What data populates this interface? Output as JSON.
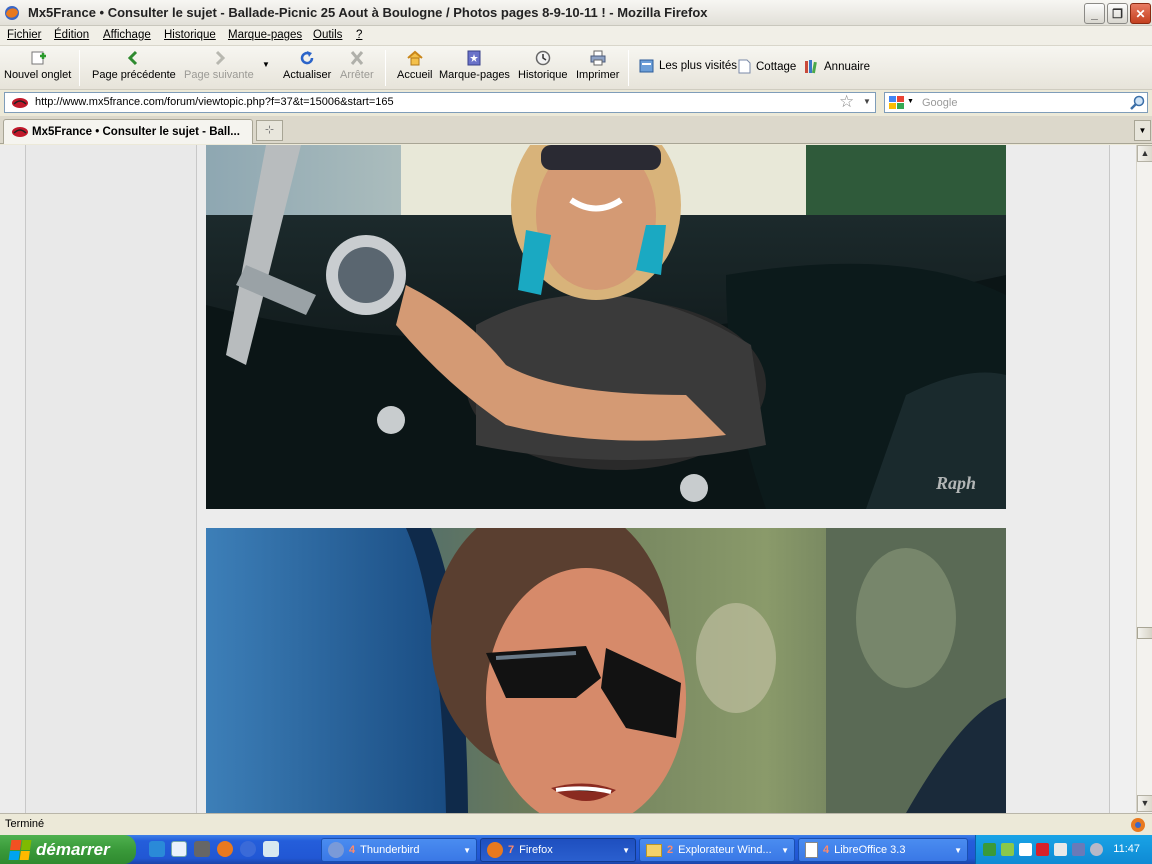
{
  "window": {
    "title": "Mx5France • Consulter le sujet - Ballade-Picnic 25 Aout à Boulogne / Photos pages 8-9-10-11 ! - Mozilla Firefox"
  },
  "menu": [
    "Fichier",
    "Édition",
    "Affichage",
    "Historique",
    "Marque-pages",
    "Outils",
    "?"
  ],
  "nav": {
    "new_tab": "Nouvel onglet",
    "back": "Page précédente",
    "forward": "Page suivante",
    "reload": "Actualiser",
    "stop": "Arrêter",
    "home": "Accueil",
    "bookmarks": "Marque-pages",
    "history": "Historique",
    "print": "Imprimer"
  },
  "bookmarks": [
    "Les plus visités",
    "Cottage",
    "Annuaire"
  ],
  "url": "http://www.mx5france.com/forum/viewtopic.php?f=37&t=15006&start=165",
  "search": {
    "placeholder": "Google"
  },
  "tab": {
    "title": "Mx5France • Consulter le sujet - Ball..."
  },
  "photo1": {
    "watermark": "Raph"
  },
  "status": "Terminé",
  "taskbar": {
    "start": "démarrer",
    "buttons": [
      {
        "count": "4",
        "label": "Thunderbird"
      },
      {
        "count": "7",
        "label": "Firefox"
      },
      {
        "count": "2",
        "label": "Explorateur Wind..."
      },
      {
        "count": "4",
        "label": "LibreOffice 3.3"
      }
    ],
    "clock": "11:47"
  },
  "colors": {
    "accent": "#245edb",
    "tray": "#0f8ad4",
    "start": "#3a9a3a"
  }
}
